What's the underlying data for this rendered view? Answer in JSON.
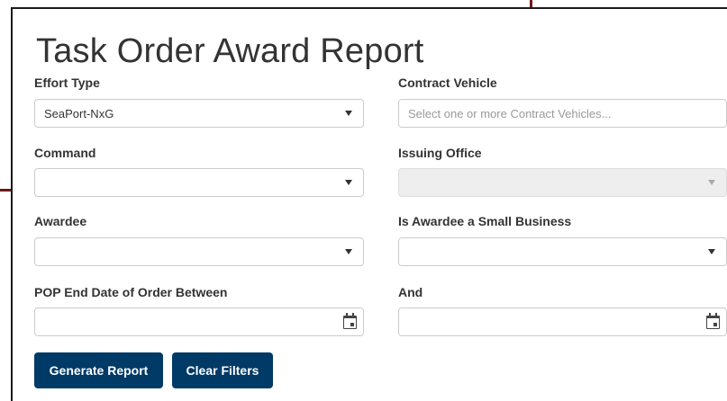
{
  "title": "Task Order Award Report",
  "fields": {
    "effort_type": {
      "label": "Effort Type",
      "value": "SeaPort-NxG"
    },
    "contract_vehicle": {
      "label": "Contract Vehicle",
      "placeholder": "Select one or more Contract Vehicles..."
    },
    "command": {
      "label": "Command",
      "value": ""
    },
    "issuing_office": {
      "label": "Issuing Office",
      "value": ""
    },
    "awardee": {
      "label": "Awardee",
      "value": ""
    },
    "small_business": {
      "label": "Is Awardee a Small Business",
      "value": ""
    },
    "pop_end_start": {
      "label": "POP End Date of Order Between",
      "value": ""
    },
    "pop_end_end": {
      "label": "And",
      "value": ""
    }
  },
  "buttons": {
    "generate": "Generate Report",
    "clear": "Clear Filters"
  },
  "colors": {
    "button_bg": "#003a66",
    "accent_line": "#6b1a1a"
  },
  "icons": {
    "dropdown": "caret-down-icon",
    "date": "calendar-icon"
  }
}
